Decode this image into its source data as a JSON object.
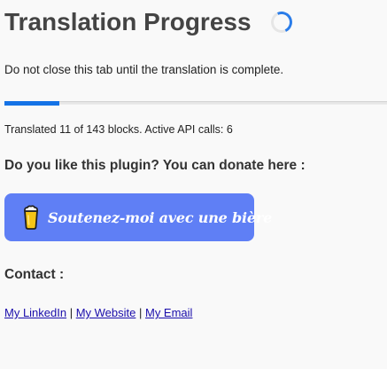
{
  "header": {
    "title": "Translation Progress"
  },
  "notice": "Do not close this tab until the translation is complete.",
  "progress": {
    "translated": 11,
    "total": 143,
    "fraction": 0.0769,
    "status_text": "Translated 11 of 143 blocks. Active API calls: 6",
    "fill_color": "#1573e6",
    "track_color": "#e6e6e6"
  },
  "donate": {
    "heading": "Do you like this plugin? You can donate here :",
    "button_label": "Soutenez-moi avec une bière",
    "button_color": "#5f7ff5",
    "icon": "beer-icon"
  },
  "contact": {
    "heading": "Contact :",
    "separator": " | ",
    "links": [
      {
        "label": "My LinkedIn"
      },
      {
        "label": "My Website"
      },
      {
        "label": "My Email"
      }
    ]
  },
  "icons": {
    "loading": "loading-spinner-icon"
  }
}
